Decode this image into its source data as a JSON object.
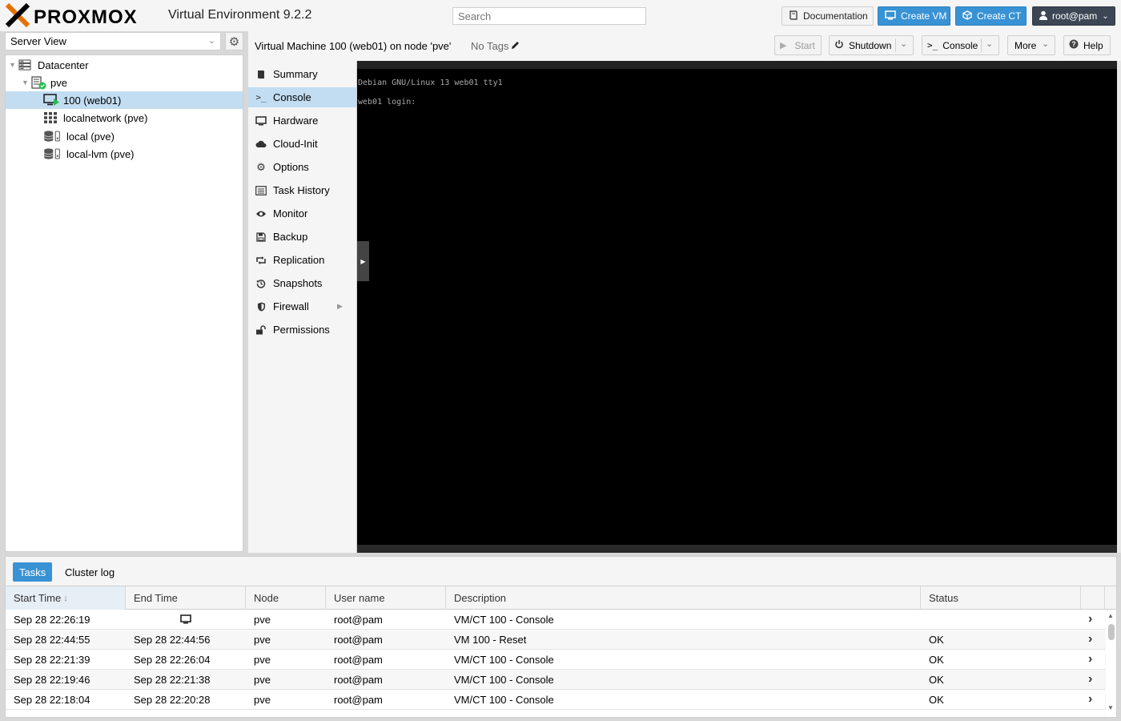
{
  "header": {
    "brand": "PROXMOX",
    "version_title": "Virtual Environment 9.2.2",
    "search_placeholder": "Search",
    "documentation_label": "Documentation",
    "create_vm_label": "Create VM",
    "create_ct_label": "Create CT",
    "user_label": "root@pam"
  },
  "resource_tree": {
    "view_label": "Server View",
    "nodes": [
      {
        "label": "Datacenter",
        "icon": "datacenter-icon"
      },
      {
        "label": "pve",
        "icon": "node-online-icon"
      },
      {
        "label": "100 (web01)",
        "icon": "vm-running-icon",
        "selected": true
      },
      {
        "label": "localnetwork (pve)",
        "icon": "sdn-zone-icon"
      },
      {
        "label": "local (pve)",
        "icon": "storage-icon"
      },
      {
        "label": "local-lvm (pve)",
        "icon": "storage-icon"
      }
    ]
  },
  "vm_header": {
    "title": "Virtual Machine 100 (web01) on node 'pve'",
    "tags_label": "No Tags",
    "start_label": "Start",
    "shutdown_label": "Shutdown",
    "console_label": "Console",
    "more_label": "More",
    "help_label": "Help"
  },
  "vm_nav": {
    "items": [
      {
        "label": "Summary",
        "icon": "book-icon"
      },
      {
        "label": "Console",
        "icon": "terminal-icon",
        "selected": true
      },
      {
        "label": "Hardware",
        "icon": "desktop-icon"
      },
      {
        "label": "Cloud-Init",
        "icon": "cloud-icon"
      },
      {
        "label": "Options",
        "icon": "gear-icon"
      },
      {
        "label": "Task History",
        "icon": "list-icon"
      },
      {
        "label": "Monitor",
        "icon": "eye-icon"
      },
      {
        "label": "Backup",
        "icon": "floppy-icon"
      },
      {
        "label": "Replication",
        "icon": "retweet-icon"
      },
      {
        "label": "Snapshots",
        "icon": "history-icon"
      },
      {
        "label": "Firewall",
        "icon": "shield-icon"
      },
      {
        "label": "Permissions",
        "icon": "unlock-icon"
      }
    ]
  },
  "console": {
    "lines": [
      "Debian GNU/Linux 13 web01 tty1",
      "web01 login:"
    ]
  },
  "bottom_panel": {
    "tabs": [
      "Tasks",
      "Cluster log"
    ],
    "columns": [
      "Start Time",
      "End Time",
      "Node",
      "User name",
      "Description",
      "Status"
    ],
    "rows": [
      {
        "start": "Sep 28 22:26:19",
        "end": "",
        "end_icon": "monitor-icon",
        "node": "pve",
        "user": "root@pam",
        "desc": "VM/CT 100 - Console",
        "status": ""
      },
      {
        "start": "Sep 28 22:44:55",
        "end": "Sep 28 22:44:56",
        "node": "pve",
        "user": "root@pam",
        "desc": "VM 100 - Reset",
        "status": "OK"
      },
      {
        "start": "Sep 28 22:21:39",
        "end": "Sep 28 22:26:04",
        "node": "pve",
        "user": "root@pam",
        "desc": "VM/CT 100 - Console",
        "status": "OK"
      },
      {
        "start": "Sep 28 22:19:46",
        "end": "Sep 28 22:21:38",
        "node": "pve",
        "user": "root@pam",
        "desc": "VM/CT 100 - Console",
        "status": "OK"
      },
      {
        "start": "Sep 28 22:18:04",
        "end": "Sep 28 22:20:28",
        "node": "pve",
        "user": "root@pam",
        "desc": "VM/CT 100 - Console",
        "status": "OK"
      }
    ]
  },
  "colors": {
    "accent": "#3892d4",
    "selection": "#c2ddf2",
    "proxmox_orange": "#e57000",
    "running_green": "#21bf4b"
  }
}
